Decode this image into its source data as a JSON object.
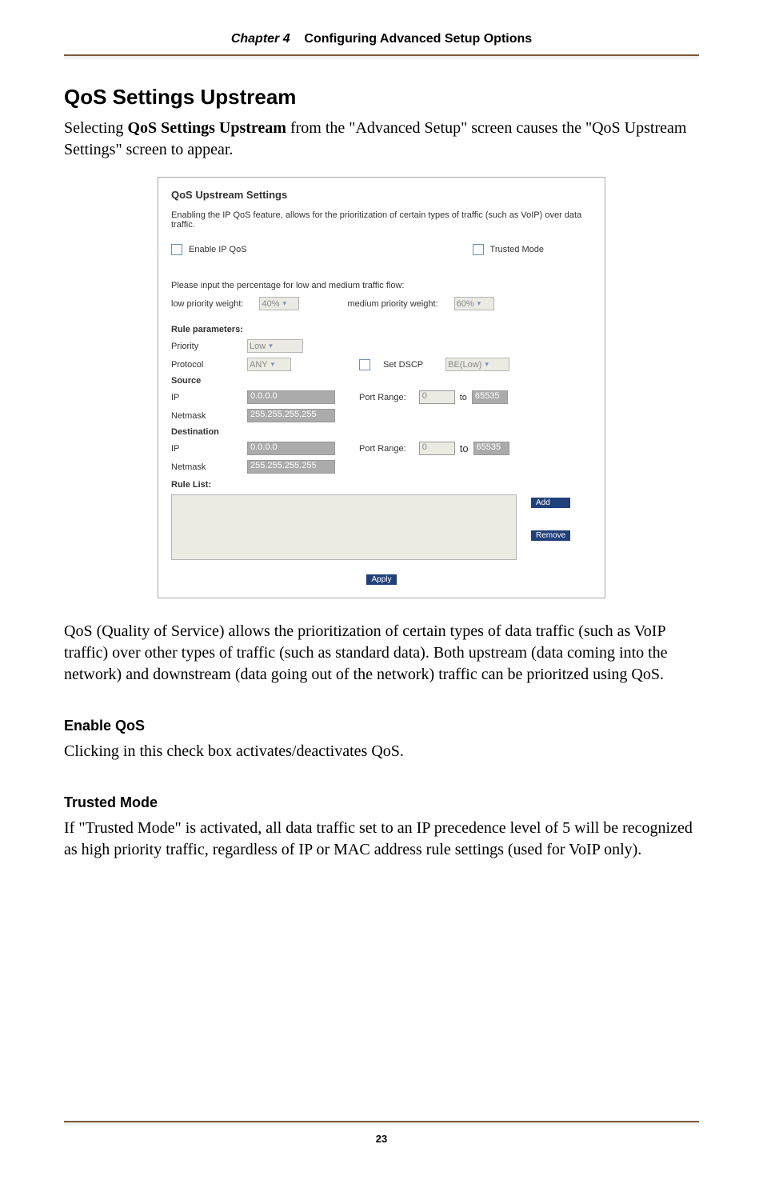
{
  "header": {
    "chapter_label": "Chapter 4",
    "chapter_title": "Configuring Advanced Setup Options"
  },
  "section": {
    "title": "QoS Settings Upstream",
    "intro_part1": "Selecting ",
    "intro_strong": "QoS Settings Upstream",
    "intro_part2": " from the \"Advanced Setup\" screen causes the \"QoS Upstream Settings\" screen to appear."
  },
  "screenshot": {
    "title": "QoS Upstream Settings",
    "description": "Enabling the IP QoS feature, allows for the prioritization of certain types of traffic (such as VoIP) over data traffic.",
    "enable_label": "Enable IP QoS",
    "trusted_label": "Trusted Mode",
    "percentage_prompt": "Please input the percentage for low and medium traffic flow:",
    "low_priority_label": "low priority weight:",
    "low_priority_value": "40%",
    "medium_priority_label": "medium priority weight:",
    "medium_priority_value": "60%",
    "rule_parameters_title": "Rule parameters:",
    "priority_label": "Priority",
    "priority_value": "Low",
    "protocol_label": "Protocol",
    "protocol_value": "ANY",
    "set_dscp_label": "Set DSCP",
    "dscp_value": "BE(Low)",
    "source_label": "Source",
    "destination_label": "Destination",
    "ip_label": "IP",
    "netmask_label": "Netmask",
    "ip_placeholder": "0.0.0.0",
    "netmask_placeholder": "255.255.255.255",
    "port_range_label": "Port Range:",
    "port_from": "0",
    "port_to_word": "to",
    "port_to": "65535",
    "rule_list_title": "Rule List:",
    "add_button": "Add",
    "remove_button": "Remove",
    "apply_button": "Apply"
  },
  "body_paragraph": "QoS (Quality of Service) allows the prioritization of certain types of data traffic (such as VoIP traffic) over other types of traffic (such as standard data). Both upstream (data coming into the network) and downstream (data going out of the network) traffic can be prioritzed using QoS.",
  "enable_qos": {
    "heading": "Enable QoS",
    "text": "Clicking in this check box activates/deactivates QoS."
  },
  "trusted_mode": {
    "heading": "Trusted Mode",
    "text": "If \"Trusted Mode\" is activated, all data traffic set to an IP precedence level of 5 will be recognized as high priority traffic, regardless of IP or MAC address rule settings (used for VoIP only)."
  },
  "page_number": "23"
}
